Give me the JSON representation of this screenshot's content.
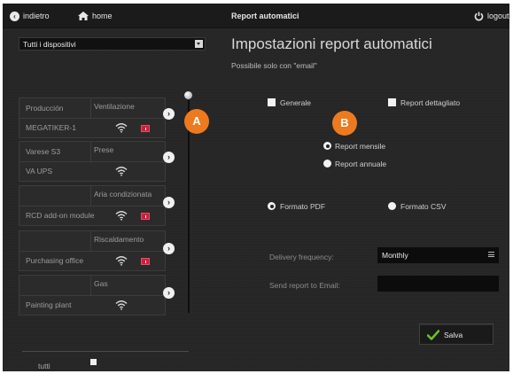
{
  "topbar": {
    "back_label": "indietro",
    "home_label": "home",
    "title": "Report automatici",
    "logout_label": "logout"
  },
  "device_filter": {
    "selected": "Tutti i dispositivi"
  },
  "device_groups": [
    {
      "site": "Producción",
      "category": "Ventilazione",
      "device": "MEGATIKER-1",
      "alarm": true
    },
    {
      "site": "Varese S3",
      "category": "Prese",
      "device": "VA UPS",
      "alarm": false
    },
    {
      "site": "",
      "category": "Aria condizionata",
      "device": "RCD add-on module",
      "alarm": true
    },
    {
      "site": "",
      "category": "Riscaldamento",
      "device": "Purchasing office",
      "alarm": true
    },
    {
      "site": "",
      "category": "Gas",
      "device": "Painting plant",
      "alarm": false
    }
  ],
  "select_all": {
    "label": "tutti",
    "checked": false
  },
  "settings": {
    "title": "Impostazioni report automatici",
    "subtitle": "Possibile solo con \"email\"",
    "report_types": [
      {
        "label": "Generale",
        "checked": false
      },
      {
        "label": "Report dettagliato",
        "checked": false
      }
    ],
    "periods": [
      {
        "label": "Report mensile",
        "selected": true
      },
      {
        "label": "Report annuale",
        "selected": false
      }
    ],
    "formats": [
      {
        "label": "Formato PDF",
        "selected": true
      },
      {
        "label": "Formato CSV",
        "selected": false
      }
    ],
    "delivery_frequency": {
      "label": "Delivery frequency:",
      "value": "Monthly"
    },
    "email": {
      "label": "Send report to Email:",
      "value": ""
    },
    "save_label": "Salva"
  },
  "badges": {
    "a": "A",
    "b": "B"
  },
  "colors": {
    "accent": "#ee7a1f",
    "alarm": "#cc1f3d",
    "save_check": "#6bbf2a"
  },
  "icons": [
    "back-icon",
    "home-icon",
    "power-icon",
    "wifi-icon",
    "alarm-icon",
    "chevron-right-icon",
    "menu-icon",
    "check-icon"
  ]
}
